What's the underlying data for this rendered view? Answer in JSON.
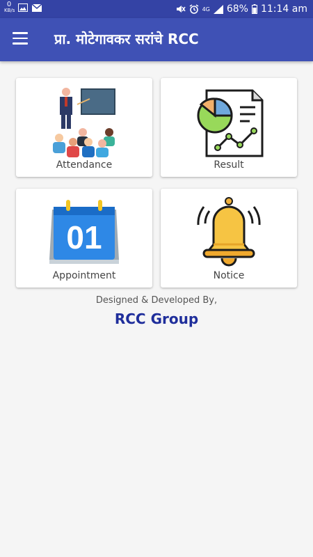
{
  "status_bar": {
    "net_speed_value": "0",
    "net_speed_unit": "KB/s",
    "network": "4G",
    "battery": "68%",
    "time": "11:14 am"
  },
  "app_bar": {
    "title": "प्रा. मोटेगावकर सरांचे RCC"
  },
  "tiles": [
    {
      "label": "Attendance",
      "icon": "classroom-icon"
    },
    {
      "label": "Result",
      "icon": "report-chart-icon"
    },
    {
      "label": "Appointment",
      "icon": "calendar-icon"
    },
    {
      "label": "Notice",
      "icon": "bell-icon"
    }
  ],
  "calendar_day": "01",
  "footer": {
    "designed_by": "Designed & Developed By,",
    "company": "RCC Group"
  },
  "colors": {
    "status_bar": "#3443a5",
    "app_bar": "#3f51b5",
    "company_text": "#1f2e9b",
    "background": "#f5f5f5"
  }
}
